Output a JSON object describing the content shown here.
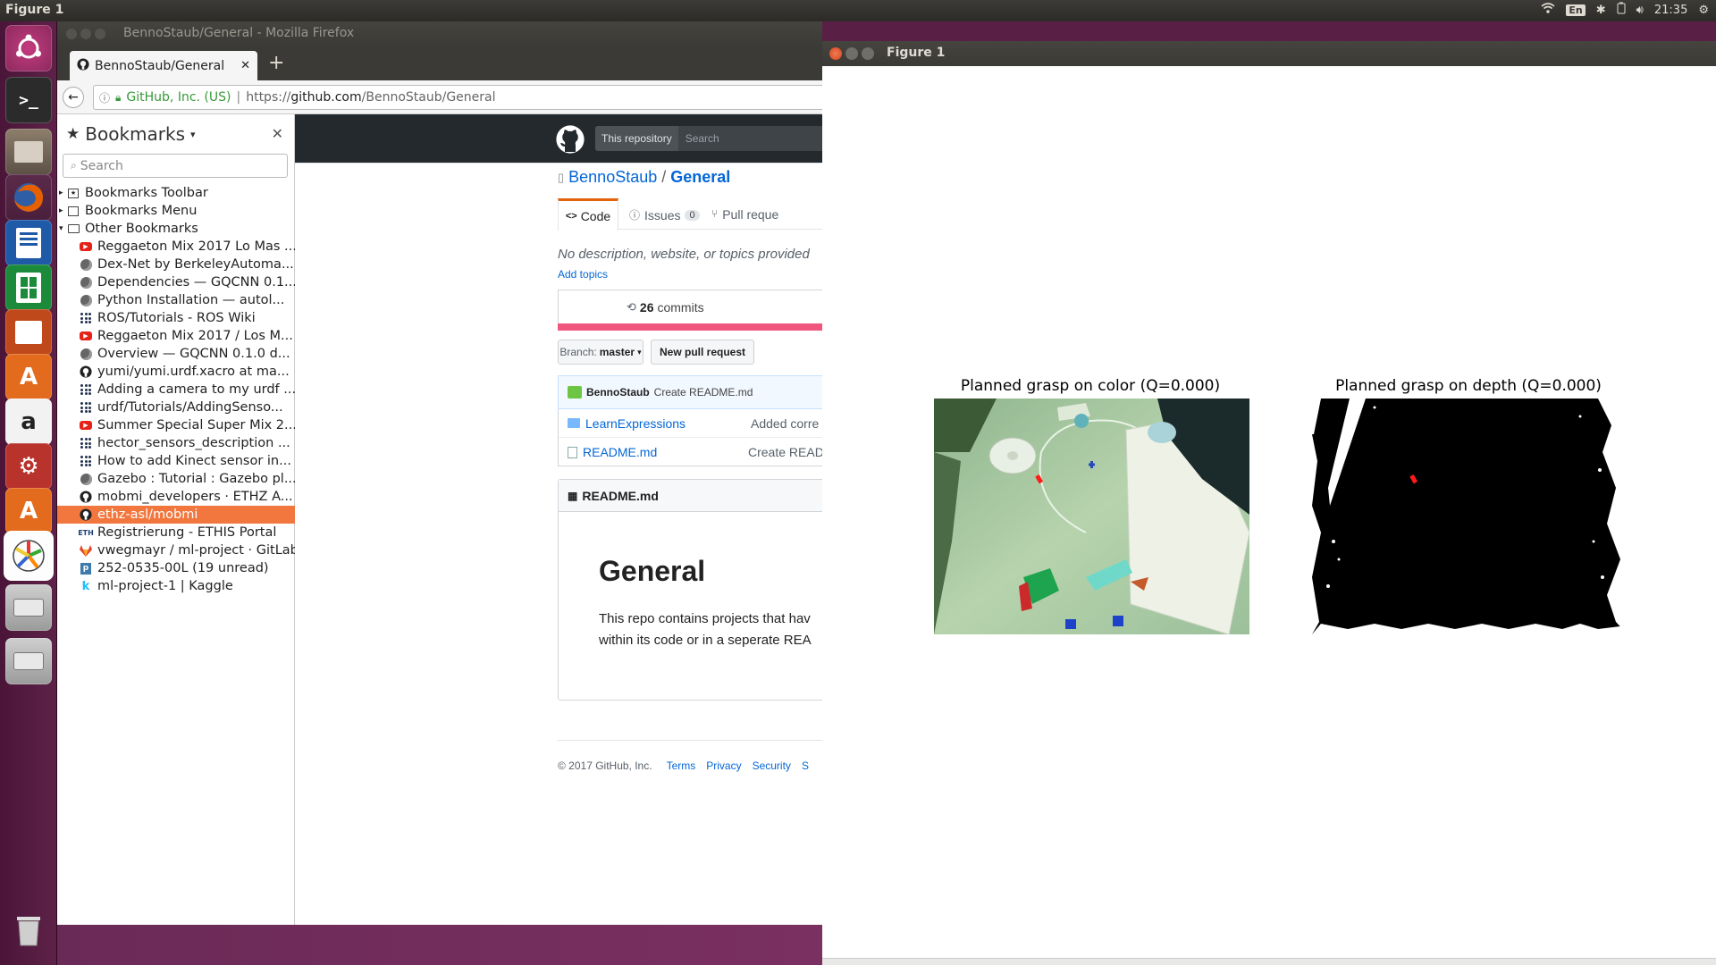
{
  "top_panel": {
    "title": "Figure 1",
    "keyboard": "En",
    "clock": "21:35"
  },
  "launcher": {
    "items": [
      "ubuntu-icon",
      "terminal-icon",
      "files-icon",
      "firefox-icon",
      "writer-icon",
      "calc-icon",
      "impress-icon",
      "software-center-icon",
      "amazon-icon",
      "system-settings-icon",
      "software-updater-icon",
      "app-icon",
      "disk-icon",
      "disk-icon",
      "trash-icon"
    ]
  },
  "firefox": {
    "window_title": "BennoStaub/General - Mozilla Firefox",
    "tab_title": "BennoStaub/General",
    "identity": "GitHub, Inc. (US)",
    "url_prefix": "https://",
    "url_domain": "github.com",
    "url_path": "/BennoStaub/General",
    "sidebar": {
      "title": "Bookmarks",
      "search_placeholder": "Search",
      "folders": [
        "Bookmarks Toolbar",
        "Bookmarks Menu",
        "Other Bookmarks"
      ],
      "bookmarks": [
        {
          "label": "Reggaeton Mix 2017 Lo Mas ...",
          "icon": "youtube-icon"
        },
        {
          "label": "Dex-Net by BerkeleyAutoma...",
          "icon": "globe-icon"
        },
        {
          "label": "Dependencies — GQCNN 0.1...",
          "icon": "globe-icon"
        },
        {
          "label": "Python Installation — autol...",
          "icon": "globe-icon"
        },
        {
          "label": "ROS/Tutorials - ROS Wiki",
          "icon": "ros-icon"
        },
        {
          "label": "Reggaeton Mix 2017 / Los M...",
          "icon": "youtube-icon"
        },
        {
          "label": "Overview — GQCNN 0.1.0 d...",
          "icon": "globe-icon"
        },
        {
          "label": "yumi/yumi.urdf.xacro at ma...",
          "icon": "github-icon"
        },
        {
          "label": "Adding a camera to my urdf ...",
          "icon": "ros-icon"
        },
        {
          "label": "urdf/Tutorials/AddingSenso...",
          "icon": "ros-icon"
        },
        {
          "label": "Summer Special Super Mix 2...",
          "icon": "youtube-icon"
        },
        {
          "label": "hector_sensors_description ...",
          "icon": "ros-icon"
        },
        {
          "label": "How to add Kinect sensor in...",
          "icon": "ros-icon"
        },
        {
          "label": "Gazebo : Tutorial : Gazebo pl...",
          "icon": "globe-icon"
        },
        {
          "label": "mobmi_developers · ETHZ A...",
          "icon": "github-icon"
        },
        {
          "label": "ethz-asl/mobmi",
          "icon": "github-icon",
          "selected": true
        },
        {
          "label": "Registrierung - ETHIS Portal",
          "icon": "eth-icon"
        },
        {
          "label": "vwegmayr / ml-project · GitLab",
          "icon": "gitlab-icon"
        },
        {
          "label": "252-0535-00L (19 unread)",
          "icon": "piazza-icon"
        },
        {
          "label": "ml-project-1 | Kaggle",
          "icon": "kaggle-icon"
        }
      ]
    },
    "github": {
      "scope_button": "This repository",
      "search_placeholder": "Search",
      "owner": "BennoStaub",
      "separator": "/",
      "repo": "General",
      "tabs": {
        "code": "Code",
        "issues": "Issues",
        "issues_count": "0",
        "pulls": "Pull reque"
      },
      "description": "No description, website, or topics provided",
      "add_topics": "Add topics",
      "commits_count": "26",
      "commits_label": "commits",
      "branch_label": "Branch:",
      "branch_name": "master",
      "new_pr": "New pull request",
      "last_commit_author": "BennoStaub",
      "last_commit_msg": "Create README.md",
      "files": [
        {
          "name": "LearnExpressions",
          "type": "folder",
          "msg": "Added corre"
        },
        {
          "name": "README.md",
          "type": "file",
          "msg": "Create READ"
        }
      ],
      "readme_header": "README.md",
      "readme_title": "General",
      "readme_body_1": "This repo contains projects that hav",
      "readme_body_2": "within its code or in a seperate REA",
      "footer": {
        "copyright": "© 2017 GitHub, Inc.",
        "links": [
          "Terms",
          "Privacy",
          "Security",
          "S"
        ]
      }
    }
  },
  "figure": {
    "window_title": "Figure 1",
    "subplots": [
      {
        "title": "Planned grasp on color (Q=0.000)"
      },
      {
        "title": "Planned grasp on depth (Q=0.000)"
      }
    ]
  }
}
